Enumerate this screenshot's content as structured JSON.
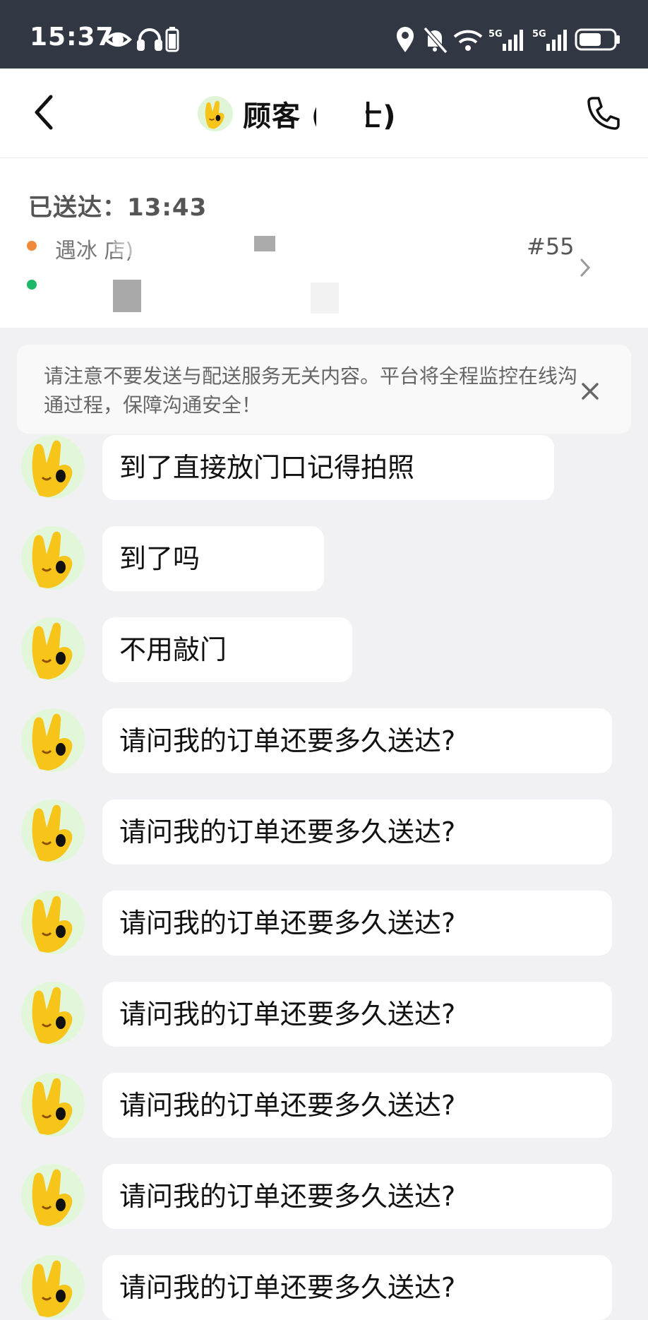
{
  "status_bar": {
    "time": "15:37",
    "network_1": "5G",
    "network_2": "5G",
    "icons": [
      "eye-icon",
      "headphones-icon",
      "battery-small-icon",
      "location-icon",
      "mute-icon",
      "wifi-icon",
      "signal-icon",
      "battery-icon"
    ]
  },
  "header": {
    "title": "顾客    (女士)",
    "back_icon": "chevron-left-icon",
    "call_icon": "phone-icon"
  },
  "order": {
    "status": "已送达：13:43",
    "store_name": "遇冰         店)",
    "order_number": "#55"
  },
  "notice": {
    "text": "请注意不要发送与配送服务无关内容。平台将全程监控在线沟通过程，保障沟通安全！"
  },
  "messages": [
    {
      "text": "到了直接放门口记得拍照"
    },
    {
      "text": "到了吗"
    },
    {
      "text": "不用敲门"
    },
    {
      "text": "请问我的订单还要多久送达?"
    },
    {
      "text": "请问我的订单还要多久送达?"
    },
    {
      "text": "请问我的订单还要多久送达?"
    },
    {
      "text": "请问我的订单还要多久送达?"
    },
    {
      "text": "请问我的订单还要多久送达?"
    },
    {
      "text": "请问我的订单还要多久送达?"
    },
    {
      "text": "请问我的订单还要多久送达?"
    }
  ]
}
